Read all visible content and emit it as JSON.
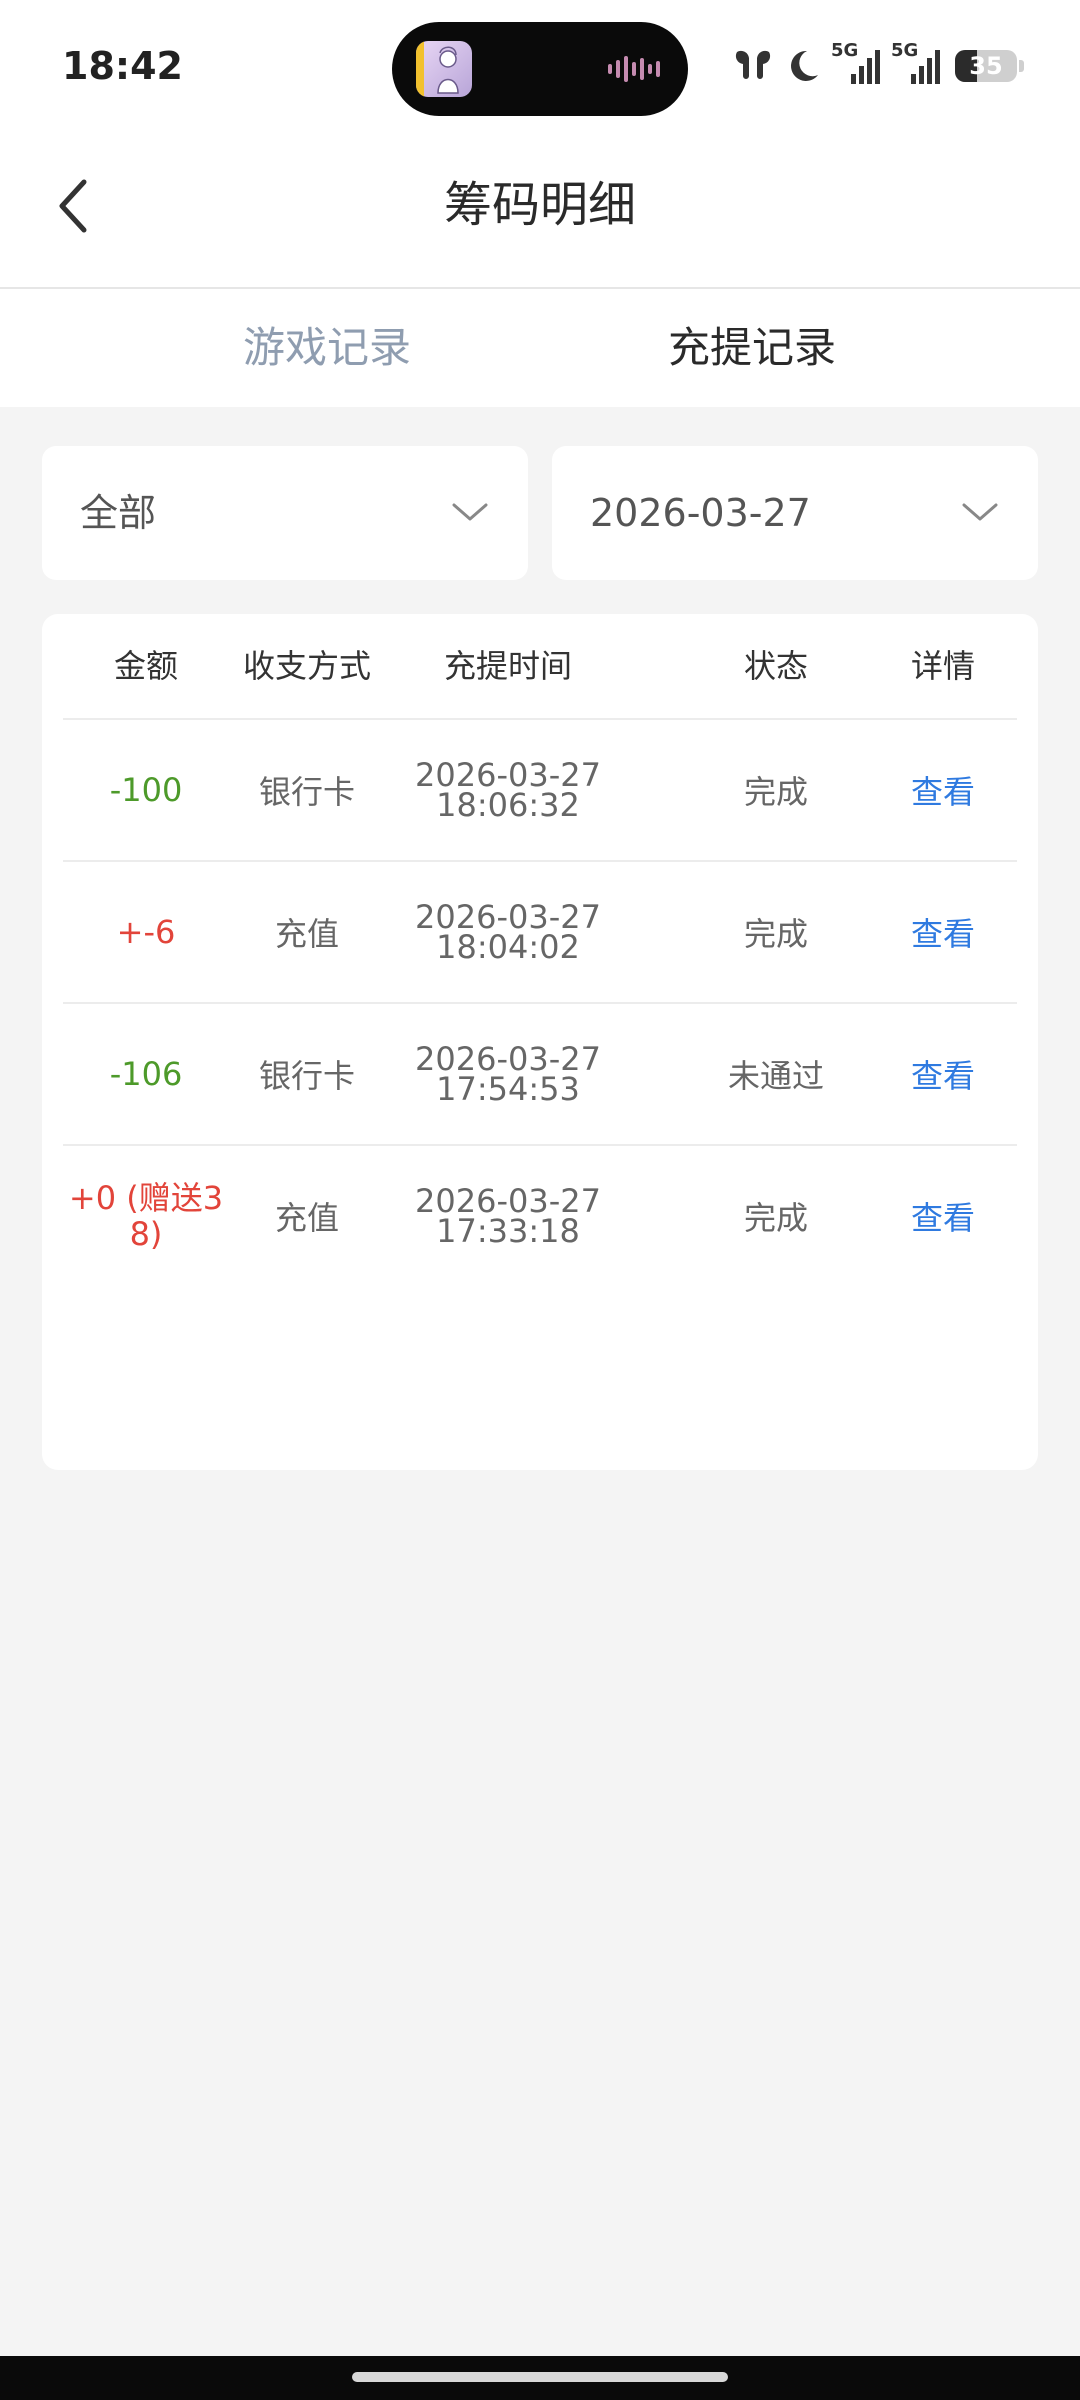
{
  "status_bar": {
    "time": "18:42",
    "network_1": "5G",
    "network_2": "5G",
    "battery_level": "35",
    "icons": [
      "earbuds-icon",
      "do-not-disturb-moon-icon",
      "signal-5g-icon",
      "signal-5g-icon",
      "battery-icon"
    ]
  },
  "header": {
    "title": "筹码明细",
    "back_icon": "chevron-left-icon"
  },
  "tabs": [
    {
      "label": "游戏记录",
      "active": false
    },
    {
      "label": "充提记录",
      "active": true
    }
  ],
  "filters": {
    "type": "全部",
    "date": "2026-03-27"
  },
  "table": {
    "columns": [
      "金额",
      "收支方式",
      "充提时间",
      "状态",
      "详情"
    ],
    "rows": [
      {
        "amount": "-100",
        "method": "银行卡",
        "date": "2026-03-27",
        "time": "18:06:32",
        "status": "完成",
        "detail": "查看"
      },
      {
        "amount": "+-6",
        "method": "充值",
        "date": "2026-03-27",
        "time": "18:04:02",
        "status": "完成",
        "detail": "查看"
      },
      {
        "amount": "-106",
        "method": "银行卡",
        "date": "2026-03-27",
        "time": "17:54:53",
        "status": "未通过",
        "detail": "查看"
      },
      {
        "amount_line1": "+0 (赠送3",
        "amount_line2": "8)",
        "method": "充值",
        "date": "2026-03-27",
        "time": "17:33:18",
        "status": "完成",
        "detail": "查看"
      }
    ]
  },
  "colors": {
    "negative_amount": "#4d9a2a",
    "positive_amount": "#e2443a",
    "link": "#2f7ae0",
    "inactive_tab": "#8f9db0"
  }
}
